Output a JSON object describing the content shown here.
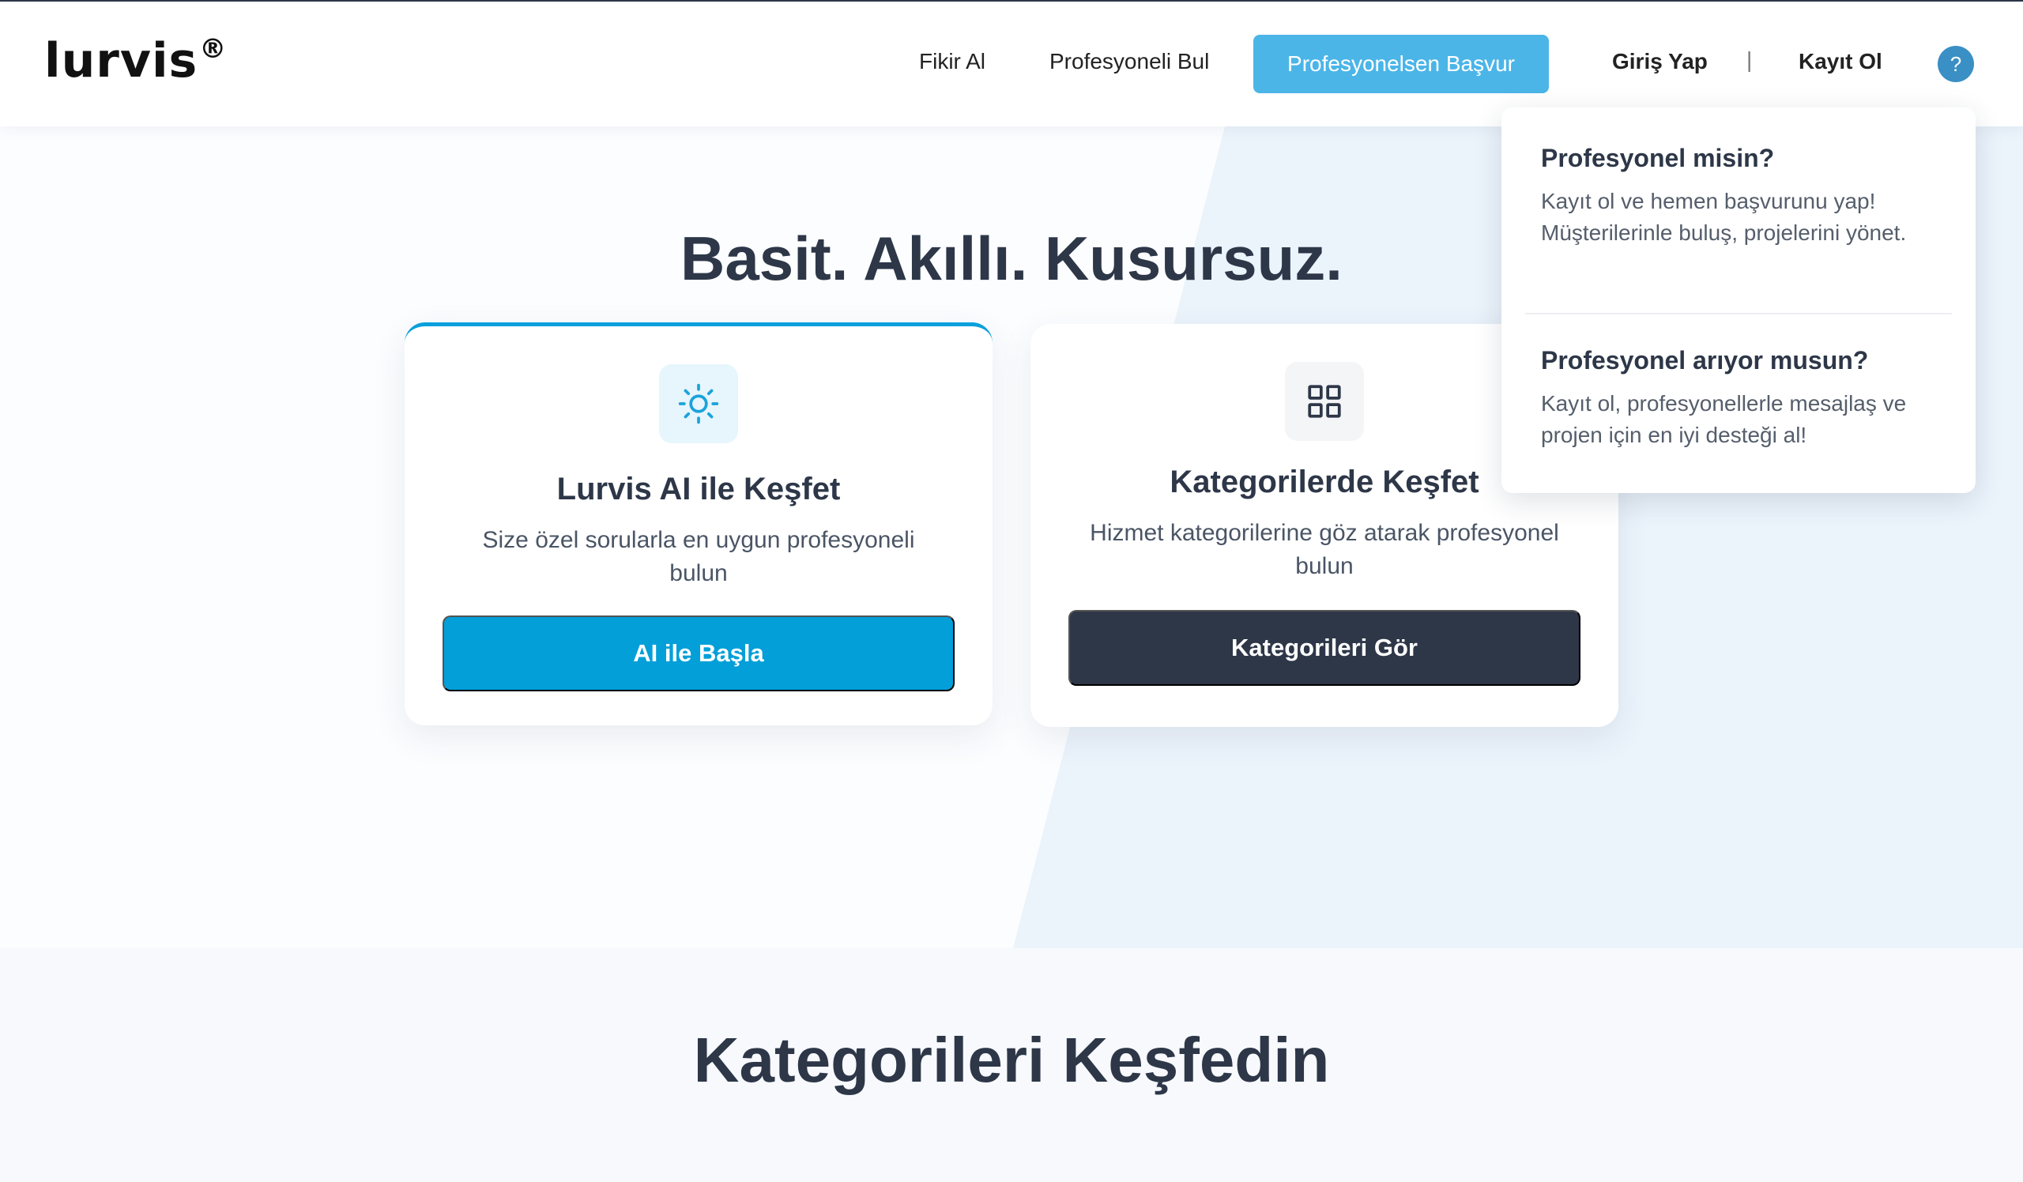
{
  "header": {
    "logo_text": "lurvis",
    "logo_mark": "®",
    "nav": {
      "idea": "Fikir Al",
      "find_pro": "Profesyoneli Bul",
      "apply_pro": "Profesyonelsen Başvur",
      "login": "Giriş Yap",
      "separator": "|",
      "register": "Kayıt Ol",
      "help": "?"
    }
  },
  "hero": {
    "title": "Basit. Akıllı. Kusursuz.",
    "cards": [
      {
        "icon": "sun-icon",
        "title": "Lurvis AI ile Keşfet",
        "description": "Size özel sorularla en uygun profesyoneli bulun",
        "button": "AI ile Başla"
      },
      {
        "icon": "grid-icon",
        "title": "Kategorilerde Keşfet",
        "description": "Hizmet kategorilerine göz atarak profesyonel bulun",
        "button": "Kategorileri Gör"
      }
    ]
  },
  "popover": {
    "sections": [
      {
        "title": "Profesyonel misin?",
        "text": "Kayıt ol ve hemen başvurunu yap! Müşterilerinle buluş, projelerini yönet."
      },
      {
        "title": "Profesyonel arıyor musun?",
        "text": "Kayıt ol, profesyonellerle mesajlaş ve projen için en iyi desteği al!"
      }
    ]
  },
  "categories": {
    "title": "Kategorileri Keşfedin"
  },
  "colors": {
    "brand_blue": "#029fd9",
    "cta_light_blue": "#4bb5e8",
    "dark": "#2d3748"
  }
}
